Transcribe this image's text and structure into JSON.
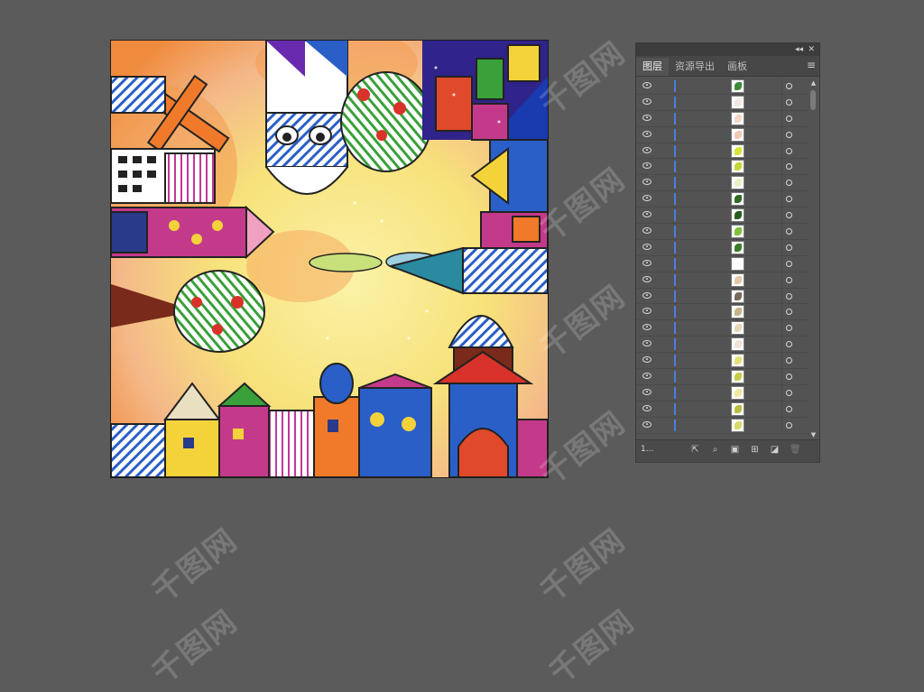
{
  "panel": {
    "collapse_icon": "double-chevron-left-icon",
    "close_icon": "close-icon",
    "tabs": [
      {
        "label": "图层",
        "active": true
      },
      {
        "label": "资源导出",
        "active": false
      },
      {
        "label": "画板",
        "active": false
      }
    ],
    "menu_icon": "hamburger-menu-icon",
    "layer_count": "1...",
    "layer_accent_color": "#4a7ee0",
    "layers": [
      {
        "thumb_color": "#3c8a3a"
      },
      {
        "thumb_color": "#f4e6e0"
      },
      {
        "thumb_color": "#f2d6c6"
      },
      {
        "thumb_color": "#efc9b6"
      },
      {
        "thumb_color": "#d9e33a"
      },
      {
        "thumb_color": "#c9d63a"
      },
      {
        "thumb_color": "#e9f1c8"
      },
      {
        "thumb_color": "#2f6b22"
      },
      {
        "thumb_color": "#295c1c"
      },
      {
        "thumb_color": "#7fbf3a"
      },
      {
        "thumb_color": "#3b7d2a"
      },
      {
        "thumb_color": "#ffffff"
      },
      {
        "thumb_color": "#e0c8a8"
      },
      {
        "thumb_color": "#7a6a58"
      },
      {
        "thumb_color": "#c8b48a"
      },
      {
        "thumb_color": "#e8d6b8"
      },
      {
        "thumb_color": "#f0e2d0"
      },
      {
        "thumb_color": "#e6e07a"
      },
      {
        "thumb_color": "#c6cc48"
      },
      {
        "thumb_color": "#f1e7a0"
      },
      {
        "thumb_color": "#b8bf3e"
      },
      {
        "thumb_color": "#d8dc6a"
      }
    ],
    "bottom_icons": [
      "export-icon",
      "search-icon",
      "make-clip-mask-icon",
      "new-sublayer-icon",
      "new-layer-icon",
      "delete-icon"
    ]
  },
  "watermark": "千图网"
}
